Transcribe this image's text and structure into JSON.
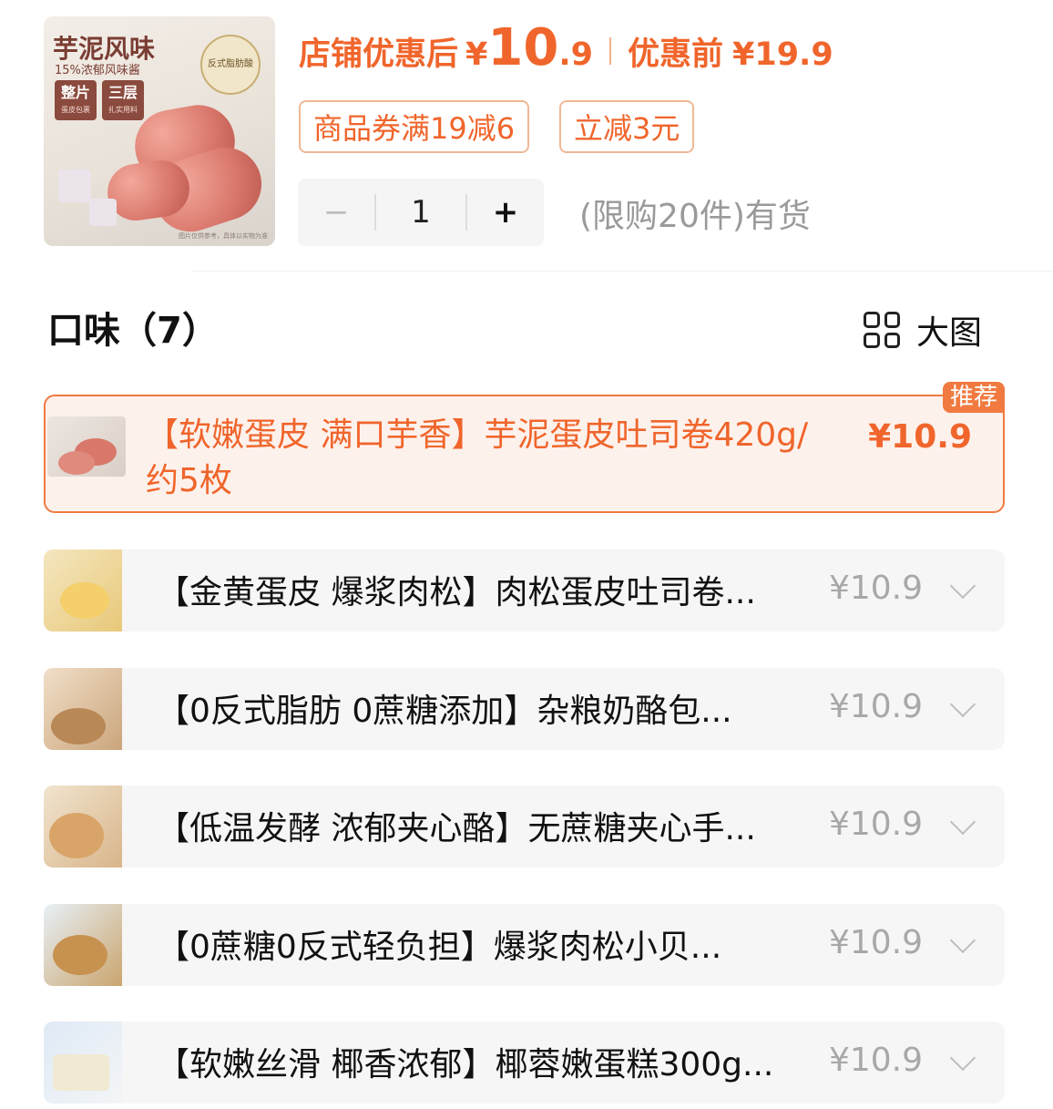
{
  "product_image": {
    "title": "芋泥风味",
    "subtitle": "15%浓郁风味酱",
    "chips": [
      {
        "label": "整片",
        "sub": "蛋皮包裹"
      },
      {
        "label": "三层",
        "sub": "扎实用料"
      }
    ],
    "badge": "反式脂肪酸",
    "note": "图片仅供参考，具体以实物为准"
  },
  "price": {
    "after_label": "店铺优惠后",
    "currency": "¥",
    "after_int": "10",
    "after_dec": ".9",
    "before_label": "优惠前",
    "before_value": "¥19.9"
  },
  "tags": [
    "商品券满19减6",
    "立减3元"
  ],
  "stepper": {
    "minus": "−",
    "qty": "1",
    "plus": "+"
  },
  "stock_text": "(限购20件)有货",
  "section": {
    "title": "口味（7）",
    "view_toggle": "大图"
  },
  "options": [
    {
      "name": "【软嫩蛋皮 满口芋香】芋泥蛋皮吐司卷420g/约5枚",
      "price": "¥10.9",
      "badge": "推荐",
      "selected": true
    },
    {
      "name": "【金黄蛋皮 爆浆肉松】肉松蛋皮吐司卷...",
      "price": "¥10.9"
    },
    {
      "name": "【0反式脂肪 0蔗糖添加】杂粮奶酪包...",
      "price": "¥10.9"
    },
    {
      "name": "【低温发酵 浓郁夹心酪】无蔗糖夹心手...",
      "price": "¥10.9"
    },
    {
      "name": "【0蔗糖0反式轻负担】爆浆肉松小贝...",
      "price": "¥10.9"
    },
    {
      "name": "【软嫩丝滑 椰香浓郁】椰蓉嫩蛋糕300g...",
      "price": "¥10.9"
    }
  ],
  "colors": {
    "accent": "#f0652b",
    "border_accent": "#f07a40",
    "muted": "#a8a8a8",
    "row_bg": "#f6f6f6"
  }
}
